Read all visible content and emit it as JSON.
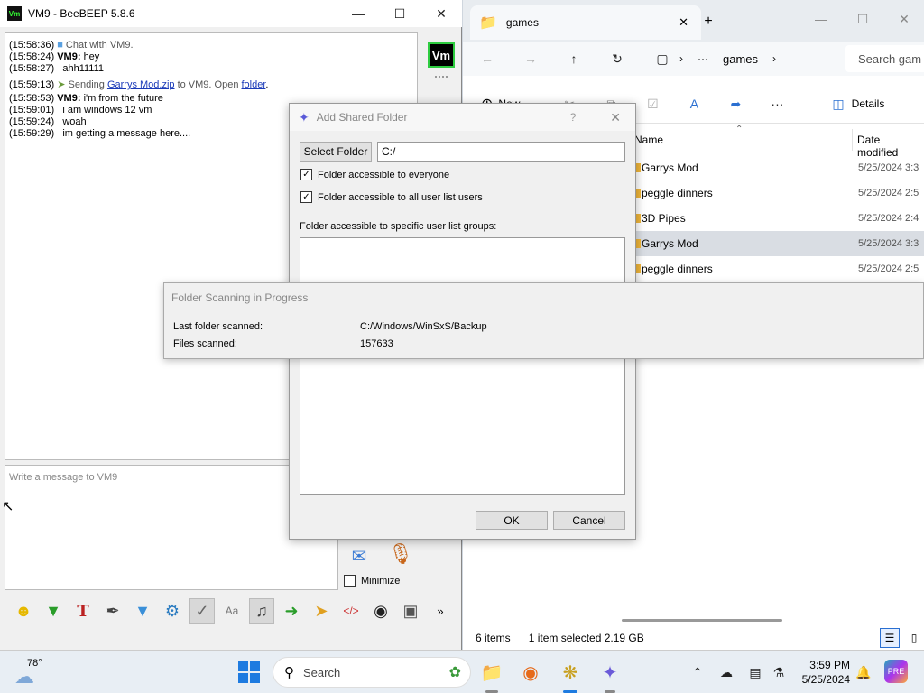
{
  "beebeep": {
    "title": "VM9 - BeeBEEP 5.8.6",
    "avatar_text": "Vm",
    "chat": [
      {
        "time": "(15:58:36)",
        "who": "",
        "text": "Chat with VM9."
      },
      {
        "time": "(15:58:24)",
        "who": "VM9:",
        "text": "hey"
      },
      {
        "time": "(15:58:27)",
        "who": "",
        "text": "ahh11111"
      },
      {
        "time": "(15:59:13)",
        "who": "",
        "text": "Sending ",
        "link1": "Garrys Mod.zip",
        "mid": " to VM9. Open ",
        "link2": "folder",
        "end": "."
      },
      {
        "time": "(15:58:53)",
        "who": "VM9:",
        "text": "i'm from the future"
      },
      {
        "time": "(15:59:01)",
        "who": "",
        "text": "i am windows 12 vm"
      },
      {
        "time": "(15:59:24)",
        "who": "",
        "text": "woah"
      },
      {
        "time": "(15:59:29)",
        "who": "",
        "text": "im getting a message here...."
      }
    ],
    "input_placeholder": "Write a message to VM9",
    "minimize_label": "Minimize",
    "more_label": "»"
  },
  "explorer": {
    "tab_title": "games",
    "new_tab": "+",
    "breadcrumb_more": "···",
    "breadcrumb_folder": "games",
    "search_placeholder": "Search gam",
    "new_label": "New",
    "details_label": "Details",
    "col_name": "Name",
    "col_date": "Date modified",
    "files": [
      {
        "name": "Garrys Mod",
        "date": "5/25/2024 3:3",
        "selected": false
      },
      {
        "name": "peggle dinners",
        "date": "5/25/2024 2:5",
        "selected": false
      },
      {
        "name": "3D Pipes",
        "date": "5/25/2024 2:4",
        "selected": false
      },
      {
        "name": "Garrys Mod",
        "date": "5/25/2024 3:3",
        "selected": true
      },
      {
        "name": "peggle dinners",
        "date": "5/25/2024 2:5",
        "selected": false
      }
    ],
    "status_items": "6 items",
    "status_selected": "1 item selected  2.19 GB"
  },
  "add_folder_dialog": {
    "title": "Add Shared Folder",
    "help": "?",
    "select_folder_label": "Select Folder",
    "path_value": "C:/",
    "check_everyone": "Folder accessible to everyone",
    "check_all_users": "Folder accessible to all user list users",
    "groups_label": "Folder accessible to specific user list groups:",
    "ok_label": "OK",
    "cancel_label": "Cancel"
  },
  "scan_dialog": {
    "title": "Folder Scanning in Progress",
    "last_label": "Last folder scanned:",
    "last_value": "C:/Windows/WinSxS/Backup",
    "files_label": "Files scanned:",
    "files_value": "157633"
  },
  "taskbar": {
    "weather_temp": "78°",
    "search_label": "Search",
    "time": "3:59 PM",
    "date": "5/25/2024"
  }
}
